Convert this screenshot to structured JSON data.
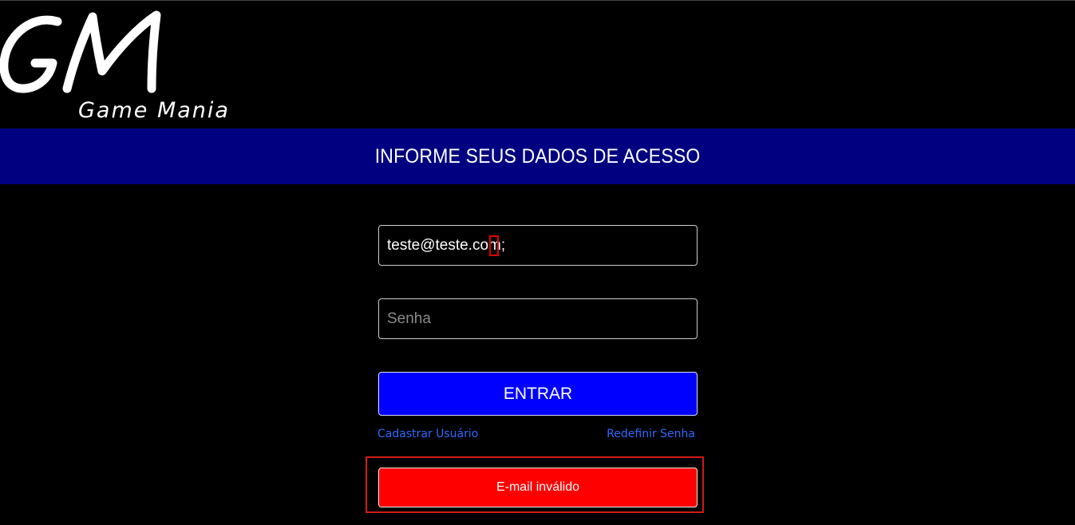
{
  "logo": {
    "monogram": "GM",
    "subtitle": "Game Mania"
  },
  "banner": {
    "title": "INFORME SEUS DADOS DE ACESSO"
  },
  "form": {
    "email_value": "teste@teste.com;",
    "password_placeholder": "Senha",
    "submit_label": "ENTRAR"
  },
  "links": {
    "register": "Cadastrar Usuário",
    "reset_password": "Redefinir Senha"
  },
  "alert": {
    "message": "E-mail inválido"
  },
  "colors": {
    "background": "#000000",
    "banner": "#000080",
    "button": "#0000ff",
    "link": "#2f6bff",
    "error": "#ff0000",
    "highlight": "#d11a1a"
  }
}
